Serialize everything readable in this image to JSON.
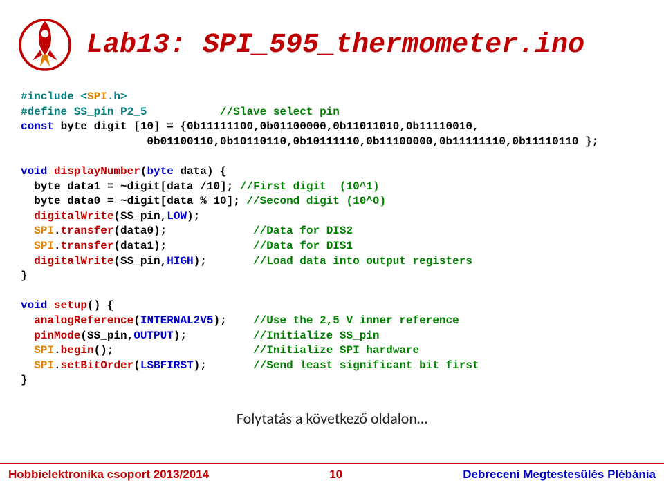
{
  "title": "Lab13: SPI_595_thermometer.ino",
  "code": {
    "l1_a": "#include <",
    "l1_b": "SPI",
    "l1_c": ".h>",
    "l2_a": "#define SS_pin P2_5           ",
    "l2_b": "//Slave select pin",
    "l3_a": "const",
    "l3_b": " byte digit [10] = {0b11111100,0b01100000,0b11011010,0b11110010,",
    "l4": "                   0b01100110,0b10110110,0b10111110,0b11100000,0b11111110,0b11110110 };",
    "l5": "",
    "l6_a": "void",
    "l6_b": " displayNumber",
    "l6_c": "(",
    "l6_d": "byte",
    "l6_e": " data) {",
    "l7_a": "  byte data1 = ~digit[data /10]; ",
    "l7_b": "//First digit  (10^1)",
    "l8_a": "  byte data0 = ~digit[data % 10];",
    "l8_b": " //Second digit (10^0)",
    "l9_a": "  digitalWrite",
    "l9_b": "(SS_pin,",
    "l9_c": "LOW",
    "l9_d": ");",
    "l10_a": "  SPI",
    "l10_b": ".",
    "l10_c": "transfer",
    "l10_d": "(data0);             ",
    "l10_e": "//Data for DIS2",
    "l11_a": "  SPI",
    "l11_b": ".",
    "l11_c": "transfer",
    "l11_d": "(data1);             ",
    "l11_e": "//Data for DIS1",
    "l12_a": "  digitalWrite",
    "l12_b": "(SS_pin,",
    "l12_c": "HIGH",
    "l12_d": ");       ",
    "l12_e": "//Load data into output registers",
    "l13": "}",
    "l14": "",
    "l15_a": "void",
    "l15_b": " setup",
    "l15_c": "() {",
    "l16_a": "  analogReference",
    "l16_b": "(",
    "l16_c": "INTERNAL2V5",
    "l16_d": ");    ",
    "l16_e": "//Use the 2,5 V inner reference",
    "l17_a": "  pinMode",
    "l17_b": "(SS_pin,",
    "l17_c": "OUTPUT",
    "l17_d": ");          ",
    "l17_e": "//Initialize SS_pin",
    "l18_a": "  SPI",
    "l18_b": ".",
    "l18_c": "begin",
    "l18_d": "();                     ",
    "l18_e": "//Initialize SPI hardware",
    "l19_a": "  SPI",
    "l19_b": ".",
    "l19_c": "setBitOrder",
    "l19_d": "(",
    "l19_e": "LSBFIRST",
    "l19_f": ");       ",
    "l19_g": "//Send least significant bit first",
    "l20": "}"
  },
  "continue": "Folytatás a következő oldalon…",
  "footer": {
    "left": "Hobbielektronika csoport 2013/2014",
    "center": "10",
    "right": "Debreceni Megtestesülés Plébánia"
  }
}
